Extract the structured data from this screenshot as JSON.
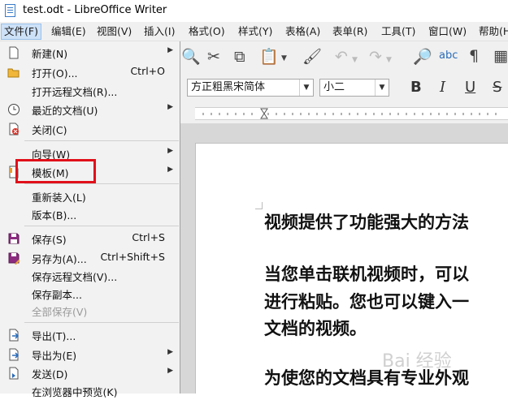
{
  "window": {
    "title": "test.odt - LibreOffice Writer"
  },
  "menubar": {
    "items": [
      {
        "label": "文件(F)"
      },
      {
        "label": "编辑(E)"
      },
      {
        "label": "视图(V)"
      },
      {
        "label": "插入(I)"
      },
      {
        "label": "格式(O)"
      },
      {
        "label": "样式(Y)"
      },
      {
        "label": "表格(A)"
      },
      {
        "label": "表单(R)"
      },
      {
        "label": "工具(T)"
      },
      {
        "label": "窗口(W)"
      },
      {
        "label": "帮助(H)"
      }
    ]
  },
  "formatting": {
    "font_name": "方正粗黑宋简体",
    "font_size": "小二",
    "bold": "B",
    "italic": "I",
    "underline": "U",
    "strike": "S"
  },
  "file_menu": {
    "items": [
      {
        "label": "新建(N)",
        "shortcut": "",
        "submenu": true,
        "icon": "new-document-icon"
      },
      {
        "label": "打开(O)...",
        "shortcut": "Ctrl+O",
        "submenu": false,
        "icon": "open-folder-icon"
      },
      {
        "label": "打开远程文档(R)...",
        "shortcut": "",
        "submenu": false,
        "icon": ""
      },
      {
        "label": "最近的文档(U)",
        "shortcut": "",
        "submenu": true,
        "icon": "recent-clock-icon"
      },
      {
        "label": "关闭(C)",
        "shortcut": "",
        "submenu": false,
        "icon": "close-document-icon"
      },
      {
        "label": "向导(W)",
        "shortcut": "",
        "submenu": true,
        "icon": ""
      },
      {
        "label": "模板(M)",
        "shortcut": "",
        "submenu": true,
        "icon": "template-icon"
      },
      {
        "label": "重新装入(L)",
        "shortcut": "",
        "submenu": false,
        "icon": ""
      },
      {
        "label": "版本(B)...",
        "shortcut": "",
        "submenu": false,
        "icon": ""
      },
      {
        "label": "保存(S)",
        "shortcut": "Ctrl+S",
        "submenu": false,
        "icon": "save-icon"
      },
      {
        "label": "另存为(A)...",
        "shortcut": "Ctrl+Shift+S",
        "submenu": false,
        "icon": "save-as-icon"
      },
      {
        "label": "保存远程文档(V)...",
        "shortcut": "",
        "submenu": false,
        "icon": ""
      },
      {
        "label": "保存副本...",
        "shortcut": "",
        "submenu": false,
        "icon": ""
      },
      {
        "label": "全部保存(V)",
        "shortcut": "",
        "submenu": false,
        "icon": "",
        "disabled": true
      },
      {
        "label": "导出(T)...",
        "shortcut": "",
        "submenu": false,
        "icon": "export-icon"
      },
      {
        "label": "导出为(E)",
        "shortcut": "",
        "submenu": true,
        "icon": "export-as-icon"
      },
      {
        "label": "发送(D)",
        "shortcut": "",
        "submenu": true,
        "icon": "send-icon"
      },
      {
        "label": "在浏览器中预览(K)",
        "shortcut": "",
        "submenu": false,
        "icon": ""
      }
    ]
  },
  "document": {
    "lines": [
      "视频提供了功能强大的方法",
      "当您单击联机视频时，可以",
      "进行粘贴。您也可以键入一",
      "文档的视频。",
      "为使您的文档具有专业外观"
    ]
  },
  "watermark": "Bai 经验",
  "colors": {
    "highlight_box": "#e0101a",
    "menu_active": "#cde1f7"
  }
}
